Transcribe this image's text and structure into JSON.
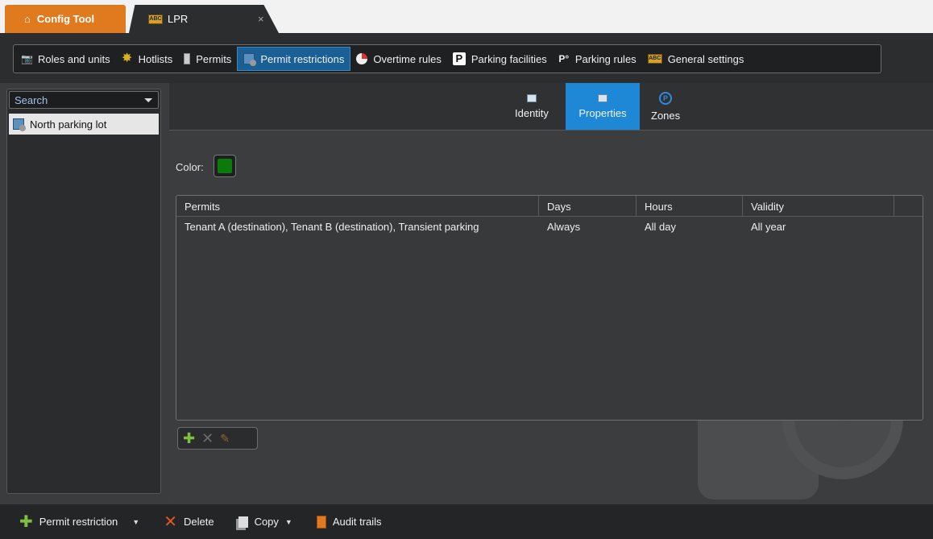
{
  "window": {
    "app_tab": "Config Tool",
    "doc_tab": "LPR",
    "doc_tab_close": "×"
  },
  "toolbar": {
    "items": [
      {
        "label": "Roles and units",
        "icon": "camera-icon"
      },
      {
        "label": "Hotlists",
        "icon": "hotlist-star-icon"
      },
      {
        "label": "Permits",
        "icon": "permit-icon"
      },
      {
        "label": "Permit restrictions",
        "icon": "permit-restriction-icon",
        "active": true
      },
      {
        "label": "Overtime rules",
        "icon": "overtime-icon"
      },
      {
        "label": "Parking facilities",
        "icon": "parking-p-icon"
      },
      {
        "label": "Parking rules",
        "icon": "parking-rules-icon"
      },
      {
        "label": "General settings",
        "icon": "lpr-plate-icon"
      }
    ]
  },
  "left_panel": {
    "search_placeholder": "Search",
    "items": [
      {
        "label": "North parking lot",
        "icon": "permit-restriction-icon",
        "selected": true
      }
    ]
  },
  "subtabs": [
    {
      "label": "Identity",
      "icon": "identity-card-icon"
    },
    {
      "label": "Properties",
      "icon": "properties-icon",
      "active": true
    },
    {
      "label": "Zones",
      "icon": "zones-p-icon"
    }
  ],
  "properties": {
    "color_label": "Color:",
    "color_value": "#0b7a0b"
  },
  "table": {
    "columns": [
      "Permits",
      "Days",
      "Hours",
      "Validity"
    ],
    "rows": [
      {
        "permits": "Tenant A (destination), Tenant B (destination), Transient parking",
        "days": "Always",
        "hours": "All day",
        "validity": "All year"
      }
    ]
  },
  "bottom_bar": {
    "add_label": "Permit restriction",
    "delete_label": "Delete",
    "copy_label": "Copy",
    "audit_label": "Audit trails"
  },
  "colors": {
    "accent_orange": "#e07a1f",
    "active_blue": "#1e88d6",
    "toolbar_active": "#1a5f96"
  }
}
